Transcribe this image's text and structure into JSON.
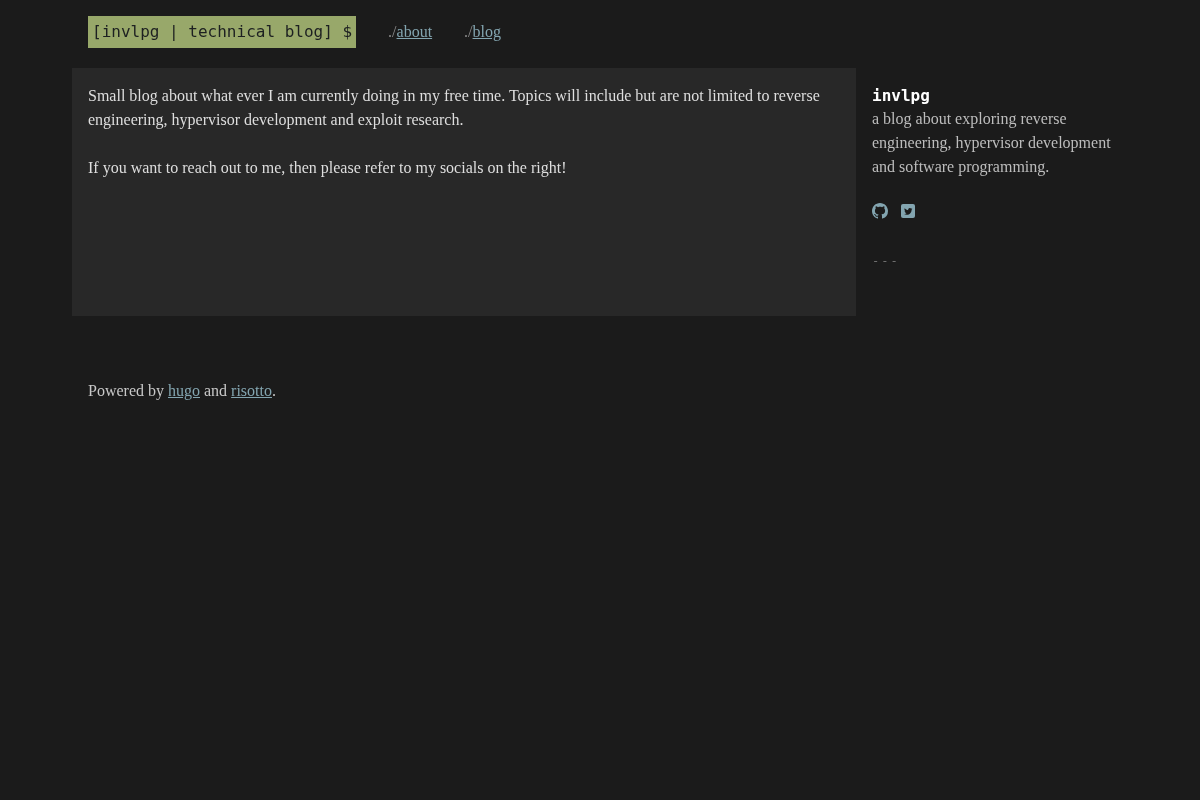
{
  "header": {
    "logo": "[invlpg | technical blog] $",
    "nav": [
      {
        "prefix": "./",
        "label": "about"
      },
      {
        "prefix": "./",
        "label": "blog"
      }
    ]
  },
  "content": {
    "paragraphs": [
      "Small blog about what ever I am currently doing in my free time. Topics will include but are not limited to reverse engineering, hypervisor development and exploit research.",
      "If you want to reach out to me, then please refer to my socials on the right!"
    ]
  },
  "sidebar": {
    "title": "invlpg",
    "description": "a blog about exploring reverse engineering, hypervisor development and software programming.",
    "socials": [
      {
        "kind": "github"
      },
      {
        "kind": "twitter"
      }
    ],
    "separator": "---"
  },
  "footer": {
    "parts": [
      {
        "kind": "text",
        "text": "Powered by "
      },
      {
        "kind": "link",
        "text": "hugo"
      },
      {
        "kind": "text",
        "text": " and "
      },
      {
        "kind": "link",
        "text": "risotto"
      },
      {
        "kind": "text",
        "text": "."
      }
    ]
  }
}
